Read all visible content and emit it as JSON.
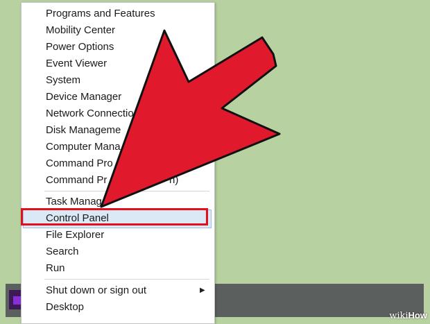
{
  "menu": {
    "items": [
      {
        "label": "Programs and Features"
      },
      {
        "label": "Mobility Center"
      },
      {
        "label": "Power Options"
      },
      {
        "label": "Event Viewer"
      },
      {
        "label": "System"
      },
      {
        "label": "Device Manager"
      },
      {
        "label": "Network Connectio"
      },
      {
        "label": "Disk Manageme"
      },
      {
        "label": "Computer Mana"
      },
      {
        "label": "Command Pro"
      },
      {
        "label": "Command Pr"
      },
      {
        "label": "Task Manager"
      },
      {
        "label": "Control Panel"
      },
      {
        "label": "File Explorer"
      },
      {
        "label": "Search"
      },
      {
        "label": "Run"
      },
      {
        "label": "Shut down or sign out"
      },
      {
        "label": "Desktop"
      }
    ],
    "command_prompt_admin_suffix": "n)",
    "submenu_chevron": "▶"
  },
  "colors": {
    "background": "#b7d1a0",
    "arrow": "#e1192d",
    "highlight_box": "#e3101c",
    "selection": "#dbe8f5"
  },
  "watermark": {
    "prefix": "wiki",
    "brand": "How"
  }
}
